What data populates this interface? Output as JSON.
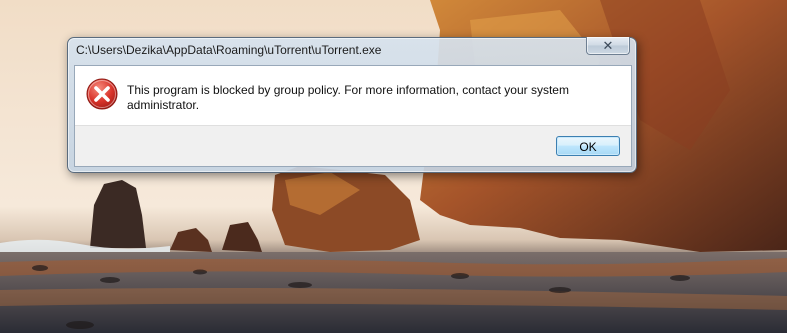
{
  "dialog": {
    "title": "C:\\Users\\Dezika\\AppData\\Roaming\\uTorrent\\uTorrent.exe",
    "message": "This program is blocked by group policy. For more information, contact your system administrator.",
    "ok_label": "OK",
    "close_glyph": "✕",
    "icon": "error-icon"
  },
  "colors": {
    "error_red": "#d9342b",
    "ok_button_border": "#3c7fb1",
    "button_area_bg": "#f0f0f0"
  }
}
